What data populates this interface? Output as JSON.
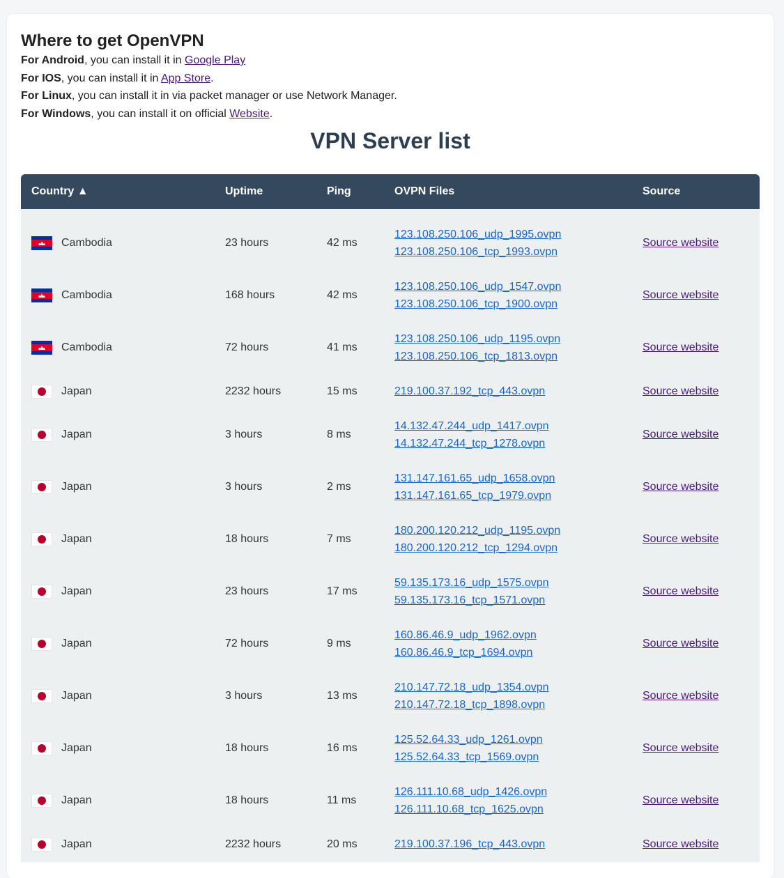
{
  "title": "Where to get OpenVPN",
  "install": [
    {
      "platform": "For Android",
      "text": ", you can install it in ",
      "link": "Google Play",
      "after": ""
    },
    {
      "platform": "For IOS",
      "text": ", you can install it in ",
      "link": "App Store",
      "after": "."
    },
    {
      "platform": "For Linux",
      "text": ", you can install it in via packet manager or use Network Manager.",
      "link": "",
      "after": ""
    },
    {
      "platform": "For Windows",
      "text": ", you can install it on official ",
      "link": "Website",
      "after": "."
    }
  ],
  "list_title": "VPN Server list",
  "columns": [
    "Country  ▲",
    "Uptime",
    "Ping",
    "OVPN Files",
    "Source"
  ],
  "source_label": "Source website",
  "colors": {
    "header": "#34495e",
    "row": "#ecf0f1",
    "link": "#1a66cc",
    "visited": "#4a1a7a"
  },
  "rows": [
    {
      "flag": "kh",
      "country": "Cambodia",
      "uptime": "23 hours",
      "ping": "42 ms",
      "files": [
        "123.108.250.106_udp_1995.ovpn",
        "123.108.250.106_tcp_1993.ovpn"
      ]
    },
    {
      "flag": "kh",
      "country": "Cambodia",
      "uptime": "168 hours",
      "ping": "42 ms",
      "files": [
        "123.108.250.106_udp_1547.ovpn",
        "123.108.250.106_tcp_1900.ovpn"
      ]
    },
    {
      "flag": "kh",
      "country": "Cambodia",
      "uptime": "72 hours",
      "ping": "41 ms",
      "files": [
        "123.108.250.106_udp_1195.ovpn",
        "123.108.250.106_tcp_1813.ovpn"
      ]
    },
    {
      "flag": "jp",
      "country": "Japan",
      "uptime": "2232 hours",
      "ping": "15 ms",
      "files": [
        "219.100.37.192_tcp_443.ovpn"
      ]
    },
    {
      "flag": "jp",
      "country": "Japan",
      "uptime": "3 hours",
      "ping": "8 ms",
      "files": [
        "14.132.47.244_udp_1417.ovpn",
        "14.132.47.244_tcp_1278.ovpn"
      ]
    },
    {
      "flag": "jp",
      "country": "Japan",
      "uptime": "3 hours",
      "ping": "2 ms",
      "files": [
        "131.147.161.65_udp_1658.ovpn",
        "131.147.161.65_tcp_1979.ovpn"
      ]
    },
    {
      "flag": "jp",
      "country": "Japan",
      "uptime": "18 hours",
      "ping": "7 ms",
      "files": [
        "180.200.120.212_udp_1195.ovpn",
        "180.200.120.212_tcp_1294.ovpn"
      ]
    },
    {
      "flag": "jp",
      "country": "Japan",
      "uptime": "23 hours",
      "ping": "17 ms",
      "files": [
        "59.135.173.16_udp_1575.ovpn",
        "59.135.173.16_tcp_1571.ovpn"
      ]
    },
    {
      "flag": "jp",
      "country": "Japan",
      "uptime": "72 hours",
      "ping": "9 ms",
      "files": [
        "160.86.46.9_udp_1962.ovpn",
        "160.86.46.9_tcp_1694.ovpn"
      ]
    },
    {
      "flag": "jp",
      "country": "Japan",
      "uptime": "3 hours",
      "ping": "13 ms",
      "files": [
        "210.147.72.18_udp_1354.ovpn",
        "210.147.72.18_tcp_1898.ovpn"
      ]
    },
    {
      "flag": "jp",
      "country": "Japan",
      "uptime": "18 hours",
      "ping": "16 ms",
      "files": [
        "125.52.64.33_udp_1261.ovpn",
        "125.52.64.33_tcp_1569.ovpn"
      ]
    },
    {
      "flag": "jp",
      "country": "Japan",
      "uptime": "18 hours",
      "ping": "11 ms",
      "files": [
        "126.111.10.68_udp_1426.ovpn",
        "126.111.10.68_tcp_1625.ovpn"
      ]
    },
    {
      "flag": "jp",
      "country": "Japan",
      "uptime": "2232 hours",
      "ping": "20 ms",
      "files": [
        "219.100.37.196_tcp_443.ovpn"
      ]
    }
  ]
}
